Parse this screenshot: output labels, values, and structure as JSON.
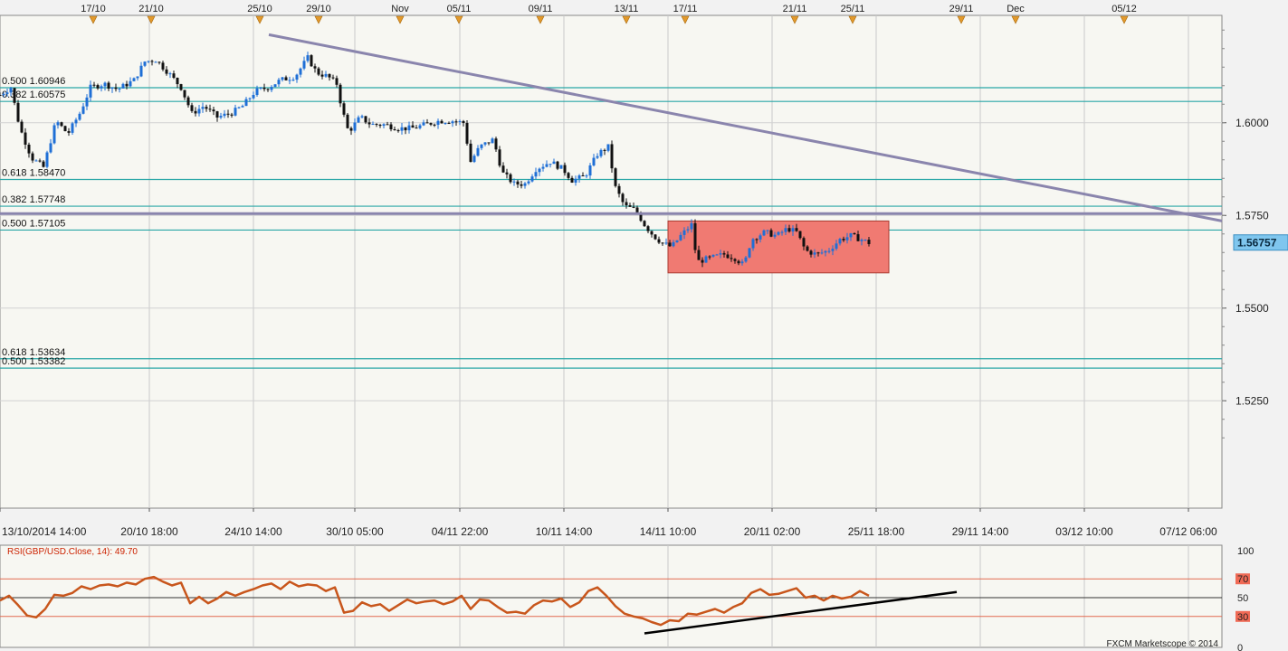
{
  "chart_data": [
    {
      "type": "candlestick",
      "instrument": "GBP/USD",
      "y_range": [
        1.4975,
        1.6275
      ],
      "x_range": [
        0,
        1350
      ],
      "price_axis_ticks": [
        "1.6000",
        "1.5750",
        "1.5500",
        "1.5250"
      ],
      "price_axis_values": [
        1.6,
        1.575,
        1.55,
        1.525
      ],
      "current_price": "1.56757",
      "current_price_value": 1.56757,
      "time_axis_ticks": [
        {
          "label": "13/10/2014 14:00",
          "x": 0
        },
        {
          "label": "20/10 18:00",
          "x": 165
        },
        {
          "label": "24/10 14:00",
          "x": 280
        },
        {
          "label": "30/10 05:00",
          "x": 392
        },
        {
          "label": "04/11 22:00",
          "x": 508
        },
        {
          "label": "10/11 14:00",
          "x": 623
        },
        {
          "label": "14/11 10:00",
          "x": 738
        },
        {
          "label": "20/11 02:00",
          "x": 853
        },
        {
          "label": "25/11 18:00",
          "x": 968
        },
        {
          "label": "29/11 14:00",
          "x": 1083
        },
        {
          "label": "03/12 10:00",
          "x": 1198
        },
        {
          "label": "07/12 06:00",
          "x": 1313
        }
      ],
      "event_markers": [
        {
          "label": "17/10",
          "x": 103
        },
        {
          "label": "21/10",
          "x": 167
        },
        {
          "label": "25/10",
          "x": 287
        },
        {
          "label": "29/10",
          "x": 352
        },
        {
          "label": "Nov",
          "x": 442
        },
        {
          "label": "05/11",
          "x": 507
        },
        {
          "label": "09/11",
          "x": 597
        },
        {
          "label": "13/11",
          "x": 692
        },
        {
          "label": "17/11",
          "x": 757
        },
        {
          "label": "21/11",
          "x": 878
        },
        {
          "label": "25/11",
          "x": 942
        },
        {
          "label": "29/11",
          "x": 1062
        },
        {
          "label": "Dec",
          "x": 1122
        },
        {
          "label": "05/12",
          "x": 1242
        }
      ],
      "fib_levels": [
        {
          "label": "0.500 1.60946",
          "value": 1.60946
        },
        {
          "label": "0.382 1.60575",
          "value": 1.60575
        },
        {
          "label": "0.618 1.58470",
          "value": 1.5847
        },
        {
          "label": "0.382 1.57748",
          "value": 1.57748
        },
        {
          "label": "0.500 1.57105",
          "value": 1.57105
        },
        {
          "label": "0.618 1.53634",
          "value": 1.53634
        },
        {
          "label": "0.500 1.53382",
          "value": 1.53382
        }
      ],
      "trendlines": [
        {
          "name": "descending-trendline",
          "from": [
            297,
            1.62375
          ],
          "to": [
            1350,
            1.5735
          ]
        },
        {
          "name": "horizontal-resistance",
          "from": [
            0,
            1.5755
          ],
          "to": [
            1350,
            1.5755
          ]
        }
      ],
      "range_box": {
        "x": [
          738,
          982
        ],
        "price": [
          1.5735,
          1.5595
        ]
      },
      "price_points": [
        [
          0,
          1.6075
        ],
        [
          12,
          1.6095
        ],
        [
          22,
          1.5985
        ],
        [
          35,
          1.5905
        ],
        [
          48,
          1.588
        ],
        [
          62,
          1.6005
        ],
        [
          75,
          1.597
        ],
        [
          88,
          1.6025
        ],
        [
          100,
          1.6095
        ],
        [
          115,
          1.6105
        ],
        [
          130,
          1.609
        ],
        [
          148,
          1.6115
        ],
        [
          160,
          1.6165
        ],
        [
          172,
          1.617
        ],
        [
          186,
          1.6135
        ],
        [
          200,
          1.6095
        ],
        [
          212,
          1.6025
        ],
        [
          225,
          1.6045
        ],
        [
          240,
          1.6015
        ],
        [
          255,
          1.6025
        ],
        [
          268,
          1.6045
        ],
        [
          282,
          1.6085
        ],
        [
          296,
          1.6095
        ],
        [
          310,
          1.6115
        ],
        [
          326,
          1.6125
        ],
        [
          340,
          1.6175
        ],
        [
          350,
          1.6135
        ],
        [
          362,
          1.6125
        ],
        [
          372,
          1.6105
        ],
        [
          378,
          1.6035
        ],
        [
          385,
          1.5975
        ],
        [
          398,
          1.6015
        ],
        [
          410,
          1.5995
        ],
        [
          425,
          1.5995
        ],
        [
          440,
          1.5985
        ],
        [
          455,
          1.5985
        ],
        [
          470,
          1.5995
        ],
        [
          485,
          1.6005
        ],
        [
          500,
          1.6005
        ],
        [
          512,
          1.6
        ],
        [
          520,
          1.5895
        ],
        [
          530,
          1.5935
        ],
        [
          545,
          1.5955
        ],
        [
          555,
          1.5865
        ],
        [
          568,
          1.5835
        ],
        [
          580,
          1.5835
        ],
        [
          592,
          1.5875
        ],
        [
          608,
          1.5895
        ],
        [
          622,
          1.5875
        ],
        [
          632,
          1.5845
        ],
        [
          646,
          1.5855
        ],
        [
          660,
          1.5915
        ],
        [
          672,
          1.5935
        ],
        [
          680,
          1.5825
        ],
        [
          690,
          1.5775
        ],
        [
          702,
          1.5765
        ],
        [
          712,
          1.5725
        ],
        [
          722,
          1.5695
        ],
        [
          732,
          1.5675
        ],
        [
          742,
          1.5665
        ],
        [
          752,
          1.5695
        ],
        [
          764,
          1.5725
        ],
        [
          770,
          1.5625
        ],
        [
          785,
          1.5635
        ],
        [
          800,
          1.5645
        ],
        [
          812,
          1.5635
        ],
        [
          822,
          1.5615
        ],
        [
          830,
          1.5685
        ],
        [
          845,
          1.5705
        ],
        [
          858,
          1.5695
        ],
        [
          870,
          1.5715
        ],
        [
          880,
          1.5705
        ],
        [
          890,
          1.5655
        ],
        [
          902,
          1.5645
        ],
        [
          915,
          1.5655
        ],
        [
          928,
          1.5685
        ],
        [
          940,
          1.5695
        ],
        [
          952,
          1.5685
        ],
        [
          960,
          1.5676
        ]
      ]
    },
    {
      "type": "line",
      "title": "RSI(GBP/USD.Close, 14): 49.70",
      "y_range": [
        0,
        100
      ],
      "axis_ticks": [
        "100",
        "70",
        "50",
        "30",
        "0"
      ],
      "axis_values": [
        100,
        70,
        50,
        30,
        0
      ],
      "reference_levels": [
        70,
        50,
        30
      ],
      "support_trendline": {
        "from": [
          712,
          12
        ],
        "to": [
          1057,
          56
        ]
      },
      "series": [
        {
          "x": [
            0,
            10,
            20,
            30,
            40,
            50,
            60,
            70,
            80,
            90,
            100,
            110,
            120,
            130,
            140,
            150,
            160,
            170,
            180,
            190,
            200,
            210,
            220,
            230,
            240,
            250,
            260,
            270,
            280,
            290,
            300,
            310,
            320,
            330,
            340,
            350,
            360,
            370,
            380,
            390,
            400,
            410,
            420,
            430,
            440,
            450,
            460,
            470,
            480,
            490,
            500,
            510,
            520,
            530,
            540,
            550,
            560,
            570,
            580,
            590,
            600,
            610,
            620,
            630,
            640,
            650,
            660,
            670,
            680,
            690,
            700,
            710,
            720,
            730,
            740,
            750,
            760,
            770,
            780,
            790,
            800,
            810,
            820,
            830,
            840,
            850,
            860,
            870,
            880,
            890,
            900,
            910,
            920,
            930,
            940,
            950,
            960
          ],
          "values": [
            47,
            52,
            42,
            31,
            29,
            38,
            53,
            52,
            55,
            62,
            59,
            63,
            64,
            62,
            66,
            64,
            70,
            72,
            67,
            63,
            66,
            44,
            51,
            44,
            49,
            56,
            52,
            56,
            59,
            63,
            65,
            59,
            67,
            62,
            64,
            63,
            57,
            61,
            34,
            36,
            45,
            41,
            43,
            36,
            42,
            48,
            44,
            46,
            47,
            43,
            46,
            52,
            38,
            48,
            47,
            40,
            34,
            35,
            33,
            42,
            47,
            46,
            49,
            40,
            45,
            57,
            61,
            52,
            41,
            33,
            30,
            28,
            24,
            21,
            26,
            25,
            33,
            32,
            35,
            38,
            34,
            40,
            44,
            55,
            59,
            53,
            54,
            57,
            60,
            50,
            52,
            47,
            52,
            49,
            51,
            57,
            52
          ]
        }
      ]
    }
  ],
  "footer": {
    "copyright": "FXCM Marketscope © 2014"
  }
}
